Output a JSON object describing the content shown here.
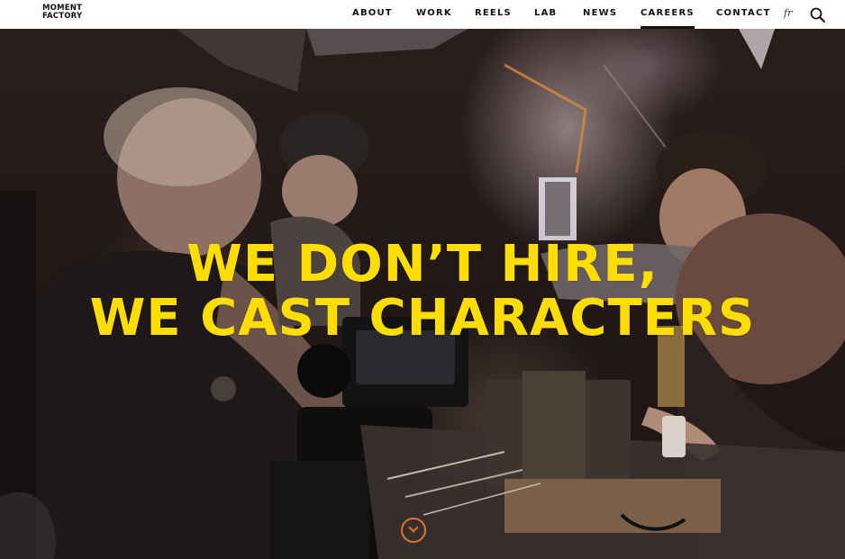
{
  "header": {
    "logo_line1": "MOMENT",
    "logo_line2": "FACTORY",
    "nav": [
      {
        "label": "ABOUT"
      },
      {
        "label": "WORK"
      },
      {
        "label": "REELS"
      },
      {
        "label": "LAB"
      },
      {
        "label": "NEWS"
      },
      {
        "label": "CAREERS",
        "active": true
      },
      {
        "label": "CONTACT"
      }
    ],
    "lang": "fr",
    "search_icon": "search-icon"
  },
  "hero": {
    "headline_line1": "WE DON’T HIRE,",
    "headline_line2": "WE CAST CHARACTERS",
    "accent_color": "#ffdd00",
    "scroll_icon": "scroll-down-icon",
    "scroll_color": "#e0742a"
  }
}
